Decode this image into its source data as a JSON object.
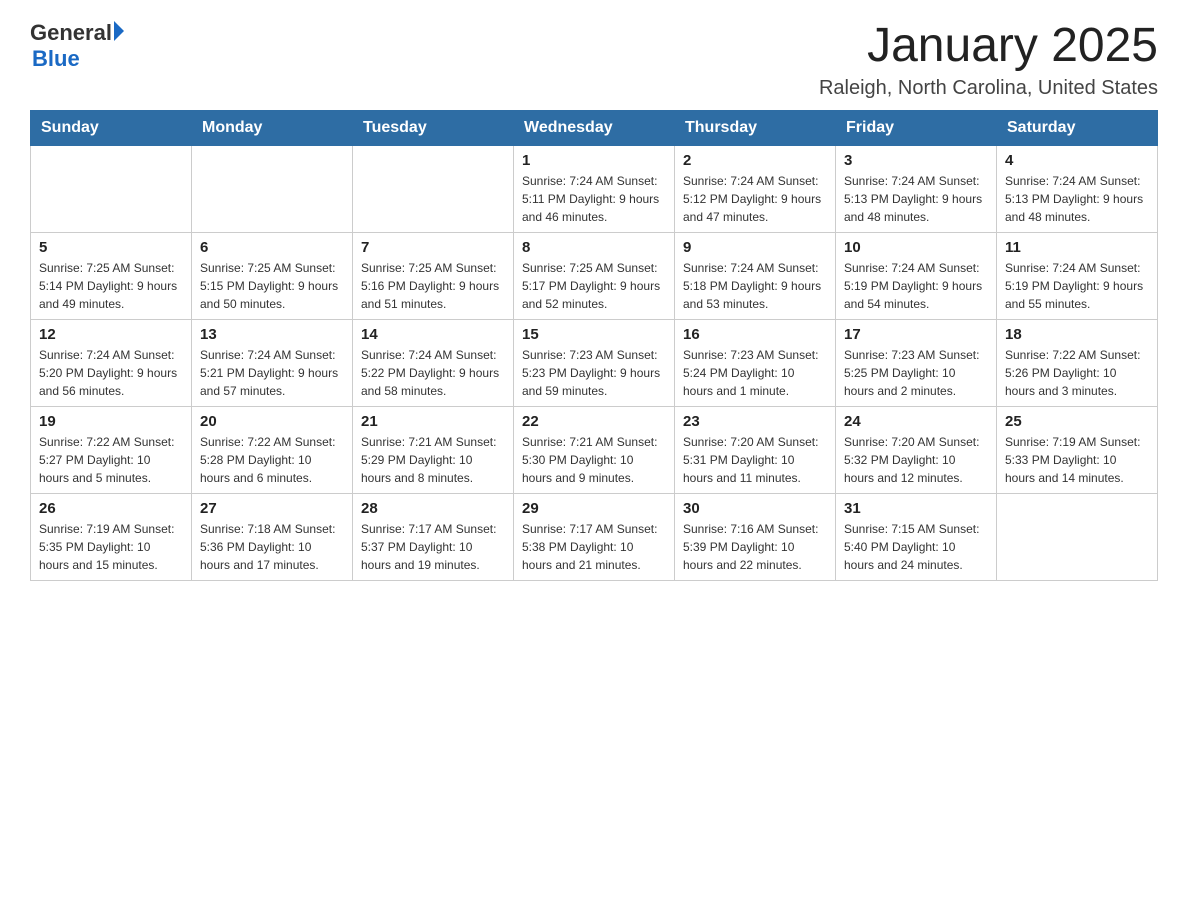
{
  "header": {
    "logo_general": "General",
    "logo_blue": "Blue",
    "title": "January 2025",
    "subtitle": "Raleigh, North Carolina, United States"
  },
  "days_of_week": [
    "Sunday",
    "Monday",
    "Tuesday",
    "Wednesday",
    "Thursday",
    "Friday",
    "Saturday"
  ],
  "weeks": [
    [
      {
        "day": "",
        "info": ""
      },
      {
        "day": "",
        "info": ""
      },
      {
        "day": "",
        "info": ""
      },
      {
        "day": "1",
        "info": "Sunrise: 7:24 AM\nSunset: 5:11 PM\nDaylight: 9 hours\nand 46 minutes."
      },
      {
        "day": "2",
        "info": "Sunrise: 7:24 AM\nSunset: 5:12 PM\nDaylight: 9 hours\nand 47 minutes."
      },
      {
        "day": "3",
        "info": "Sunrise: 7:24 AM\nSunset: 5:13 PM\nDaylight: 9 hours\nand 48 minutes."
      },
      {
        "day": "4",
        "info": "Sunrise: 7:24 AM\nSunset: 5:13 PM\nDaylight: 9 hours\nand 48 minutes."
      }
    ],
    [
      {
        "day": "5",
        "info": "Sunrise: 7:25 AM\nSunset: 5:14 PM\nDaylight: 9 hours\nand 49 minutes."
      },
      {
        "day": "6",
        "info": "Sunrise: 7:25 AM\nSunset: 5:15 PM\nDaylight: 9 hours\nand 50 minutes."
      },
      {
        "day": "7",
        "info": "Sunrise: 7:25 AM\nSunset: 5:16 PM\nDaylight: 9 hours\nand 51 minutes."
      },
      {
        "day": "8",
        "info": "Sunrise: 7:25 AM\nSunset: 5:17 PM\nDaylight: 9 hours\nand 52 minutes."
      },
      {
        "day": "9",
        "info": "Sunrise: 7:24 AM\nSunset: 5:18 PM\nDaylight: 9 hours\nand 53 minutes."
      },
      {
        "day": "10",
        "info": "Sunrise: 7:24 AM\nSunset: 5:19 PM\nDaylight: 9 hours\nand 54 minutes."
      },
      {
        "day": "11",
        "info": "Sunrise: 7:24 AM\nSunset: 5:19 PM\nDaylight: 9 hours\nand 55 minutes."
      }
    ],
    [
      {
        "day": "12",
        "info": "Sunrise: 7:24 AM\nSunset: 5:20 PM\nDaylight: 9 hours\nand 56 minutes."
      },
      {
        "day": "13",
        "info": "Sunrise: 7:24 AM\nSunset: 5:21 PM\nDaylight: 9 hours\nand 57 minutes."
      },
      {
        "day": "14",
        "info": "Sunrise: 7:24 AM\nSunset: 5:22 PM\nDaylight: 9 hours\nand 58 minutes."
      },
      {
        "day": "15",
        "info": "Sunrise: 7:23 AM\nSunset: 5:23 PM\nDaylight: 9 hours\nand 59 minutes."
      },
      {
        "day": "16",
        "info": "Sunrise: 7:23 AM\nSunset: 5:24 PM\nDaylight: 10 hours\nand 1 minute."
      },
      {
        "day": "17",
        "info": "Sunrise: 7:23 AM\nSunset: 5:25 PM\nDaylight: 10 hours\nand 2 minutes."
      },
      {
        "day": "18",
        "info": "Sunrise: 7:22 AM\nSunset: 5:26 PM\nDaylight: 10 hours\nand 3 minutes."
      }
    ],
    [
      {
        "day": "19",
        "info": "Sunrise: 7:22 AM\nSunset: 5:27 PM\nDaylight: 10 hours\nand 5 minutes."
      },
      {
        "day": "20",
        "info": "Sunrise: 7:22 AM\nSunset: 5:28 PM\nDaylight: 10 hours\nand 6 minutes."
      },
      {
        "day": "21",
        "info": "Sunrise: 7:21 AM\nSunset: 5:29 PM\nDaylight: 10 hours\nand 8 minutes."
      },
      {
        "day": "22",
        "info": "Sunrise: 7:21 AM\nSunset: 5:30 PM\nDaylight: 10 hours\nand 9 minutes."
      },
      {
        "day": "23",
        "info": "Sunrise: 7:20 AM\nSunset: 5:31 PM\nDaylight: 10 hours\nand 11 minutes."
      },
      {
        "day": "24",
        "info": "Sunrise: 7:20 AM\nSunset: 5:32 PM\nDaylight: 10 hours\nand 12 minutes."
      },
      {
        "day": "25",
        "info": "Sunrise: 7:19 AM\nSunset: 5:33 PM\nDaylight: 10 hours\nand 14 minutes."
      }
    ],
    [
      {
        "day": "26",
        "info": "Sunrise: 7:19 AM\nSunset: 5:35 PM\nDaylight: 10 hours\nand 15 minutes."
      },
      {
        "day": "27",
        "info": "Sunrise: 7:18 AM\nSunset: 5:36 PM\nDaylight: 10 hours\nand 17 minutes."
      },
      {
        "day": "28",
        "info": "Sunrise: 7:17 AM\nSunset: 5:37 PM\nDaylight: 10 hours\nand 19 minutes."
      },
      {
        "day": "29",
        "info": "Sunrise: 7:17 AM\nSunset: 5:38 PM\nDaylight: 10 hours\nand 21 minutes."
      },
      {
        "day": "30",
        "info": "Sunrise: 7:16 AM\nSunset: 5:39 PM\nDaylight: 10 hours\nand 22 minutes."
      },
      {
        "day": "31",
        "info": "Sunrise: 7:15 AM\nSunset: 5:40 PM\nDaylight: 10 hours\nand 24 minutes."
      },
      {
        "day": "",
        "info": ""
      }
    ]
  ]
}
